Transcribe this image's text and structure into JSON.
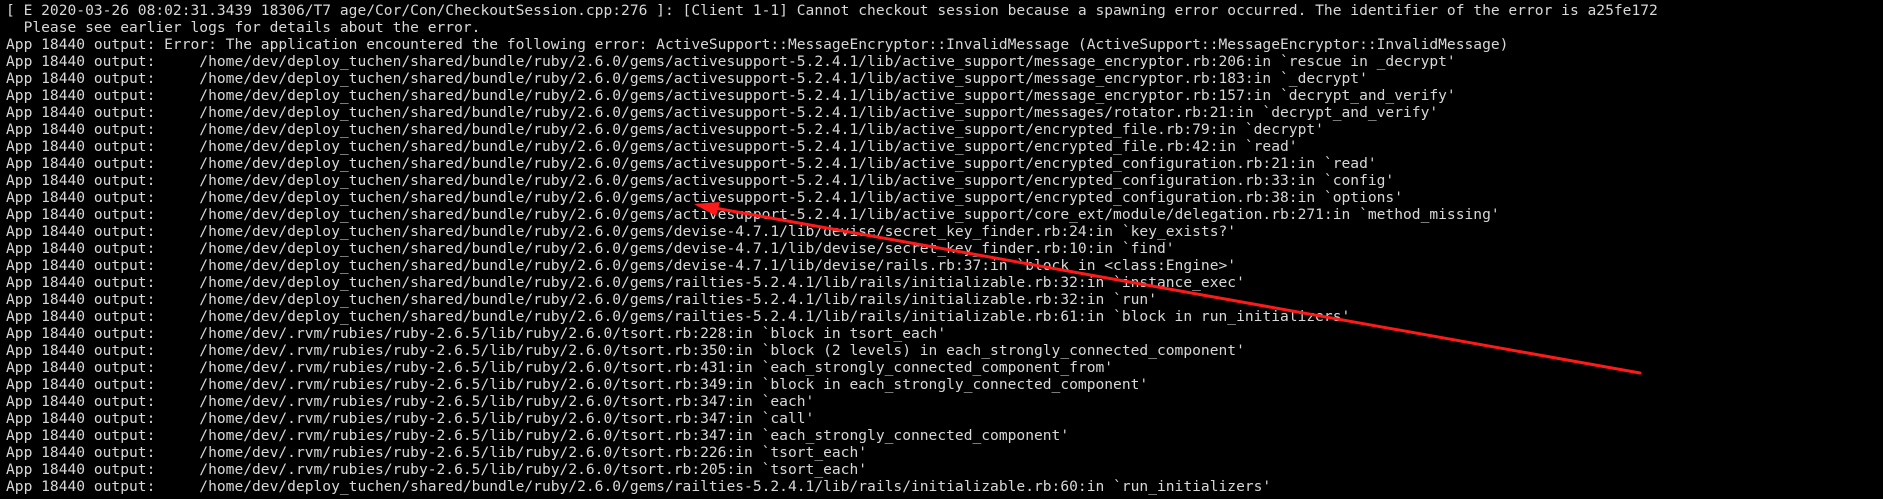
{
  "terminal": {
    "background": "#000000",
    "text_color": "#d8d8d8",
    "annotation_color": "#ff1a1a",
    "lines": [
      "[ E 2020-03-26 08:02:31.3439 18306/T7 age/Cor/Con/CheckoutSession.cpp:276 ]: [Client 1-1] Cannot checkout session because a spawning error occurred. The identifier of the error is a25fe172",
      "  Please see earlier logs for details about the error.",
      "App 18440 output: Error: The application encountered the following error: ActiveSupport::MessageEncryptor::InvalidMessage (ActiveSupport::MessageEncryptor::InvalidMessage)",
      "App 18440 output:     /home/dev/deploy_tuchen/shared/bundle/ruby/2.6.0/gems/activesupport-5.2.4.1/lib/active_support/message_encryptor.rb:206:in `rescue in _decrypt'",
      "App 18440 output:     /home/dev/deploy_tuchen/shared/bundle/ruby/2.6.0/gems/activesupport-5.2.4.1/lib/active_support/message_encryptor.rb:183:in `_decrypt'",
      "App 18440 output:     /home/dev/deploy_tuchen/shared/bundle/ruby/2.6.0/gems/activesupport-5.2.4.1/lib/active_support/message_encryptor.rb:157:in `decrypt_and_verify'",
      "App 18440 output:     /home/dev/deploy_tuchen/shared/bundle/ruby/2.6.0/gems/activesupport-5.2.4.1/lib/active_support/messages/rotator.rb:21:in `decrypt_and_verify'",
      "App 18440 output:     /home/dev/deploy_tuchen/shared/bundle/ruby/2.6.0/gems/activesupport-5.2.4.1/lib/active_support/encrypted_file.rb:79:in `decrypt'",
      "App 18440 output:     /home/dev/deploy_tuchen/shared/bundle/ruby/2.6.0/gems/activesupport-5.2.4.1/lib/active_support/encrypted_file.rb:42:in `read'",
      "App 18440 output:     /home/dev/deploy_tuchen/shared/bundle/ruby/2.6.0/gems/activesupport-5.2.4.1/lib/active_support/encrypted_configuration.rb:21:in `read'",
      "App 18440 output:     /home/dev/deploy_tuchen/shared/bundle/ruby/2.6.0/gems/activesupport-5.2.4.1/lib/active_support/encrypted_configuration.rb:33:in `config'",
      "App 18440 output:     /home/dev/deploy_tuchen/shared/bundle/ruby/2.6.0/gems/activesupport-5.2.4.1/lib/active_support/encrypted_configuration.rb:38:in `options'",
      "App 18440 output:     /home/dev/deploy_tuchen/shared/bundle/ruby/2.6.0/gems/activesupport-5.2.4.1/lib/active_support/core_ext/module/delegation.rb:271:in `method_missing'",
      "App 18440 output:     /home/dev/deploy_tuchen/shared/bundle/ruby/2.6.0/gems/devise-4.7.1/lib/devise/secret_key_finder.rb:24:in `key_exists?'",
      "App 18440 output:     /home/dev/deploy_tuchen/shared/bundle/ruby/2.6.0/gems/devise-4.7.1/lib/devise/secret_key_finder.rb:10:in `find'",
      "App 18440 output:     /home/dev/deploy_tuchen/shared/bundle/ruby/2.6.0/gems/devise-4.7.1/lib/devise/rails.rb:37:in `block in <class:Engine>'",
      "App 18440 output:     /home/dev/deploy_tuchen/shared/bundle/ruby/2.6.0/gems/railties-5.2.4.1/lib/rails/initializable.rb:32:in `instance_exec'",
      "App 18440 output:     /home/dev/deploy_tuchen/shared/bundle/ruby/2.6.0/gems/railties-5.2.4.1/lib/rails/initializable.rb:32:in `run'",
      "App 18440 output:     /home/dev/deploy_tuchen/shared/bundle/ruby/2.6.0/gems/railties-5.2.4.1/lib/rails/initializable.rb:61:in `block in run_initializers'",
      "App 18440 output:     /home/dev/.rvm/rubies/ruby-2.6.5/lib/ruby/2.6.0/tsort.rb:228:in `block in tsort_each'",
      "App 18440 output:     /home/dev/.rvm/rubies/ruby-2.6.5/lib/ruby/2.6.0/tsort.rb:350:in `block (2 levels) in each_strongly_connected_component'",
      "App 18440 output:     /home/dev/.rvm/rubies/ruby-2.6.5/lib/ruby/2.6.0/tsort.rb:431:in `each_strongly_connected_component_from'",
      "App 18440 output:     /home/dev/.rvm/rubies/ruby-2.6.5/lib/ruby/2.6.0/tsort.rb:349:in `block in each_strongly_connected_component'",
      "App 18440 output:     /home/dev/.rvm/rubies/ruby-2.6.5/lib/ruby/2.6.0/tsort.rb:347:in `each'",
      "App 18440 output:     /home/dev/.rvm/rubies/ruby-2.6.5/lib/ruby/2.6.0/tsort.rb:347:in `call'",
      "App 18440 output:     /home/dev/.rvm/rubies/ruby-2.6.5/lib/ruby/2.6.0/tsort.rb:347:in `each_strongly_connected_component'",
      "App 18440 output:     /home/dev/.rvm/rubies/ruby-2.6.5/lib/ruby/2.6.0/tsort.rb:226:in `tsort_each'",
      "App 18440 output:     /home/dev/.rvm/rubies/ruby-2.6.5/lib/ruby/2.6.0/tsort.rb:205:in `tsort_each'",
      "App 18440 output:     /home/dev/deploy_tuchen/shared/bundle/ruby/2.6.0/gems/railties-5.2.4.1/lib/rails/initializable.rb:60:in `run_initializers'"
    ]
  }
}
